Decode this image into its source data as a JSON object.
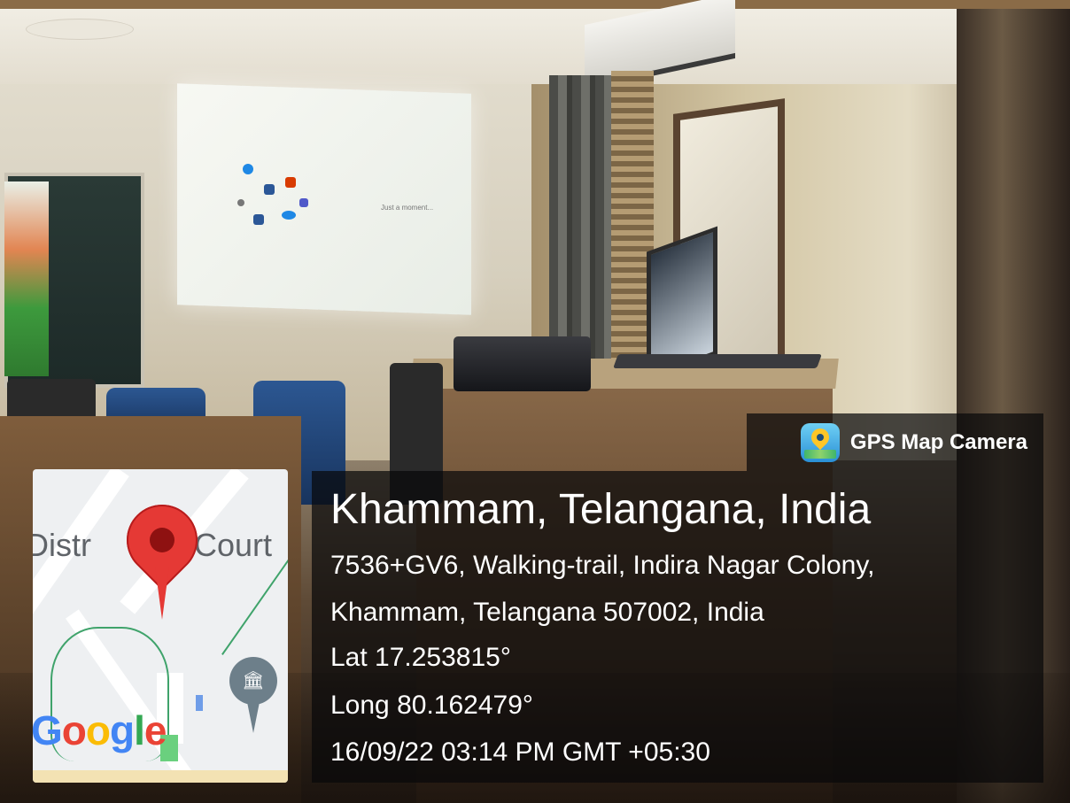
{
  "badge": {
    "label": "GPS Map Camera",
    "icon": "gps-map-camera-app-icon"
  },
  "location": {
    "title": "Khammam, Telangana, India",
    "address_line1": "7536+GV6, Walking-trail, Indira Nagar Colony,",
    "address_line2": "Khammam, Telangana 507002, India",
    "lat": "Lat 17.253815°",
    "long": "Long 80.162479°",
    "datetime": "16/09/22 03:14 PM GMT +05:30"
  },
  "map": {
    "place_label_left": "Distr",
    "place_label_right": "Court",
    "logo": "Google",
    "pin_color": "#e53935",
    "icons": [
      "location-pin-icon",
      "museum-icon"
    ]
  },
  "projected_screen": {
    "status_text": "Just a moment..."
  },
  "colors": {
    "overlay": "#08080a",
    "pin": "#e53935",
    "google_blue": "#4285f4"
  }
}
